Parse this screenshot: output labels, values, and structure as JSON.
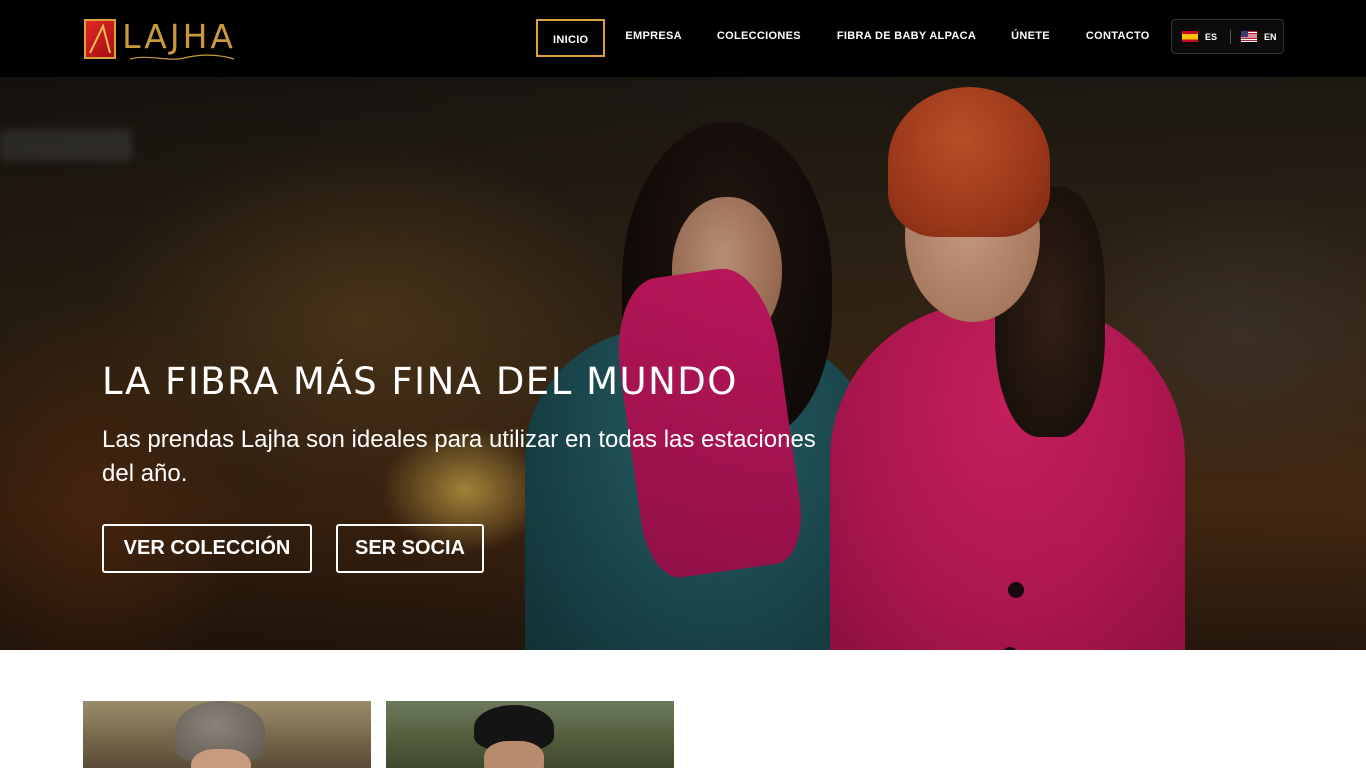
{
  "brand": {
    "name": "LAJHA",
    "logo_icon": "lajha-logo-mark"
  },
  "nav": {
    "items": [
      {
        "label": "INICIO",
        "active": true
      },
      {
        "label": "EMPRESA",
        "active": false
      },
      {
        "label": "COLECCIONES",
        "active": false
      },
      {
        "label": "FIBRA DE BABY ALPACA",
        "active": false
      },
      {
        "label": "ÚNETE",
        "active": false
      },
      {
        "label": "CONTACTO",
        "active": false
      }
    ]
  },
  "language": {
    "options": [
      {
        "code": "ES",
        "flag": "spain-flag-icon"
      },
      {
        "code": "EN",
        "flag": "usa-flag-icon"
      }
    ]
  },
  "hero": {
    "title": "LA FIBRA MÁS FINA DEL MUNDO",
    "subtitle": "Las prendas Lajha son ideales para utilizar en todas las estaciones del año.",
    "buttons": [
      {
        "label": "VER COLECCIÓN"
      },
      {
        "label": "SER SOCIA"
      }
    ]
  },
  "colors": {
    "header_bg": "#000000",
    "accent_gold": "#d9a136",
    "text_white": "#ffffff",
    "page_bg": "#ffffff"
  }
}
